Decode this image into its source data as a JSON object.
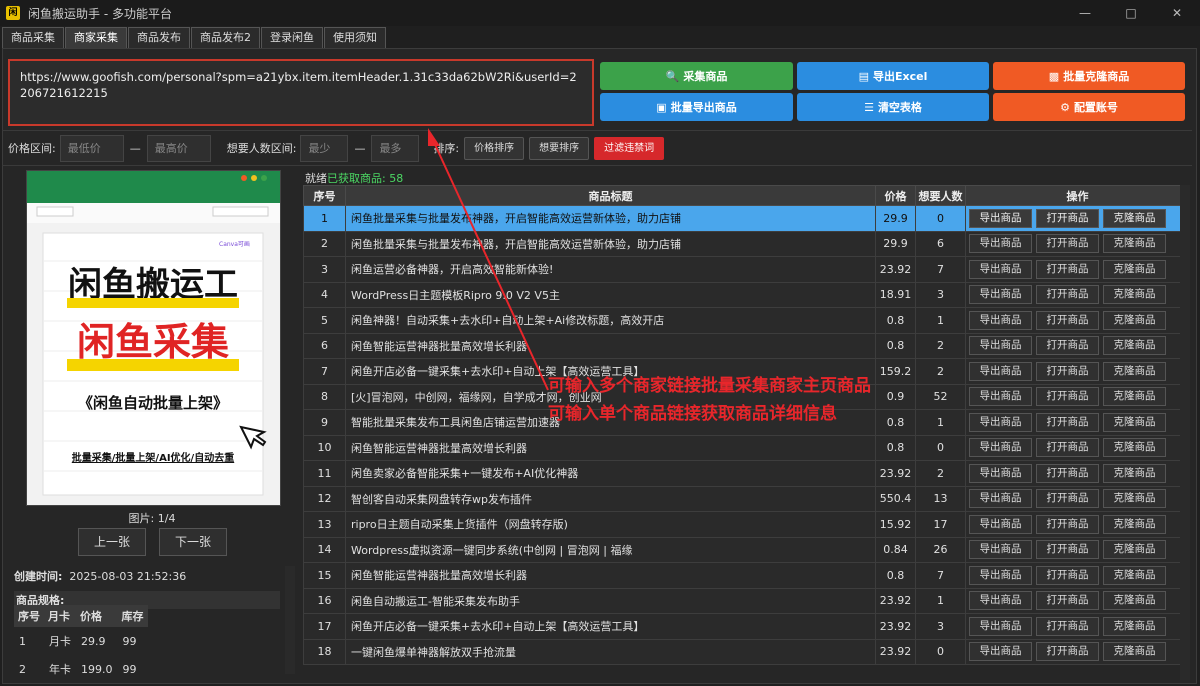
{
  "window": {
    "title": "闲鱼搬运助手 - 多功能平台",
    "icon_text": "闲"
  },
  "tabs": [
    "商品采集",
    "商家采集",
    "商品发布",
    "商品发布2",
    "登录闲鱼",
    "使用须知"
  ],
  "url_input": "https://www.goofish.com/personal?spm=a21ybx.item.itemHeader.1.31c33da62bW2Ri&userId=2206721612215",
  "buttons": {
    "collect": "采集商品",
    "export_excel": "导出Excel",
    "batch_clone": "批量克隆商品",
    "batch_export": "批量导出商品",
    "clear_table": "清空表格",
    "config_account": "配置账号"
  },
  "filters": {
    "price_label": "价格区间:",
    "price_min_ph": "最低价",
    "price_max_ph": "最高价",
    "dash": "—",
    "want_label": "想要人数区间:",
    "want_min_ph": "最少",
    "want_max_ph": "最多",
    "sort_label": "排序:",
    "sort_price": "价格排序",
    "sort_want": "想要排序",
    "filter_banned": "过滤违禁词"
  },
  "preview": {
    "caption": "图片: 1/4",
    "prev": "上一张",
    "next": "下一张",
    "poster": {
      "line1": "闲鱼搬运工",
      "line2": "闲鱼采集",
      "line3": "《闲鱼自动批量上架》",
      "line4": "批量采集/批量上架/AI优化/自动去重",
      "brand": "Canva可画"
    }
  },
  "meta": {
    "created_label": "创建时间:",
    "created_value": "2025-08-03 21:52:36",
    "spec_title": "商品规格:"
  },
  "spec": {
    "headers": [
      "序号",
      "月卡",
      "价格",
      "库存"
    ],
    "rows": [
      [
        "1",
        "月卡",
        "29.9",
        "99"
      ],
      [
        "2",
        "年卡",
        "199.0",
        "99"
      ]
    ]
  },
  "status": {
    "prefix": "就绪",
    "text": "已获取商品: 58"
  },
  "table": {
    "headers": [
      "序号",
      "商品标题",
      "价格",
      "想要人数",
      "操作"
    ],
    "ops": [
      "导出商品",
      "打开商品",
      "克隆商品"
    ],
    "rows": [
      [
        "1",
        "闲鱼批量采集与批量发布神器，开启智能高效运营新体验，助力店铺",
        "29.9",
        "0"
      ],
      [
        "2",
        "闲鱼批量采集与批量发布神器，开启智能高效运营新体验，助力店铺",
        "29.9",
        "6"
      ],
      [
        "3",
        "闲鱼运营必备神器，开启高效智能新体验!",
        "23.92",
        "7"
      ],
      [
        "4",
        "WordPress日主题模板Ripro 9.0 V2 V5主",
        "18.91",
        "3"
      ],
      [
        "5",
        "闲鱼神器！自动采集+去水印+自动上架+Ai修改标题，高效开店",
        "0.8",
        "1"
      ],
      [
        "6",
        "闲鱼智能运营神器批量高效增长利器",
        "0.8",
        "2"
      ],
      [
        "7",
        "闲鱼开店必备一键采集+去水印+自动上架【高效运营工具】",
        "159.2",
        "2"
      ],
      [
        "8",
        "[火]冒泡网，中创网，福缘网，自学成才网，创业网",
        "0.9",
        "52"
      ],
      [
        "9",
        "智能批量采集发布工具闲鱼店铺运营加速器",
        "0.8",
        "1"
      ],
      [
        "10",
        "闲鱼智能运营神器批量高效增长利器",
        "0.8",
        "0"
      ],
      [
        "11",
        "闲鱼卖家必备智能采集+一键发布+AI优化神器",
        "23.92",
        "2"
      ],
      [
        "12",
        "智创客自动采集网盘转存wp发布插件",
        "550.4",
        "13"
      ],
      [
        "13",
        "ripro日主题自动采集上货插件（网盘转存版)",
        "15.92",
        "17"
      ],
      [
        "14",
        "Wordpress虚拟资源一键同步系统(中创网 | 冒泡网 | 福缘",
        "0.84",
        "26"
      ],
      [
        "15",
        "闲鱼智能运营神器批量高效增长利器",
        "0.8",
        "7"
      ],
      [
        "16",
        "闲鱼自动搬运工-智能采集发布助手",
        "23.92",
        "1"
      ],
      [
        "17",
        "闲鱼开店必备一键采集+去水印+自动上架【高效运营工具】",
        "23.92",
        "3"
      ],
      [
        "18",
        "一键闲鱼爆单神器解放双手抢流量",
        "23.92",
        "0"
      ]
    ]
  },
  "annotation": {
    "line1": "可输入多个商家链接批量采集商家主页商品",
    "line2": "可输入单个商品链接获取商品详细信息"
  },
  "colors": {
    "green": "#3ca24a",
    "blue": "#2b8de0",
    "orange": "#f05a24",
    "red": "#d6282b",
    "selected": "#4aa6ec",
    "annotation": "#e8262b"
  }
}
